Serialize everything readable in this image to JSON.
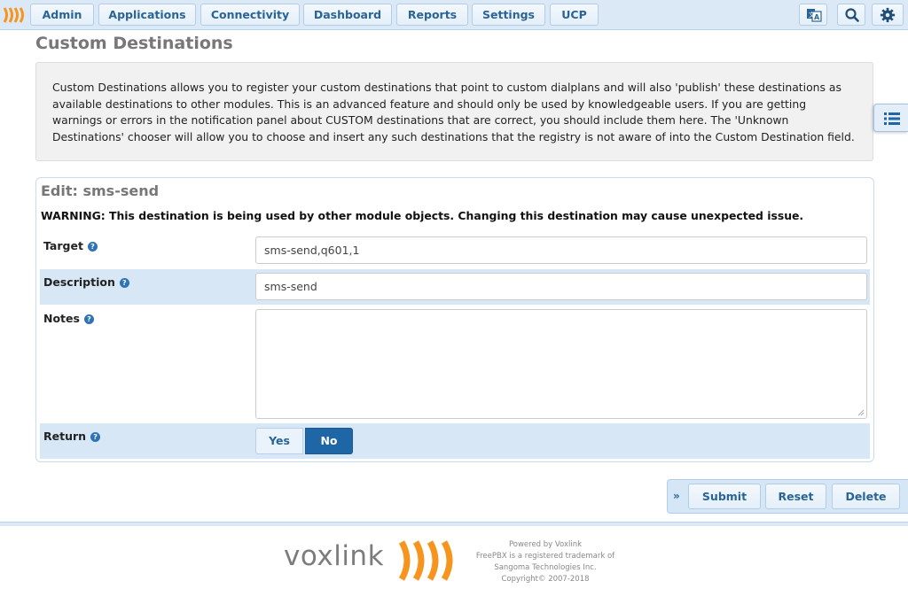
{
  "nav": {
    "items": [
      "Admin",
      "Applications",
      "Connectivity",
      "Dashboard",
      "Reports",
      "Settings",
      "UCP"
    ]
  },
  "page": {
    "title": "Custom Destinations",
    "description": "Custom Destinations allows you to register your custom destinations that point to custom dialplans and will also 'publish' these destinations as available destinations to other modules. This is an advanced feature and should only be used by knowledgeable users. If you are getting warnings or errors in the notification panel about CUSTOM destinations that are correct, you should include them here. The 'Unknown Destinations' chooser will allow you to choose and insert any such destinations that the registry is not aware of into the Custom Destination field."
  },
  "edit": {
    "title": "Edit: sms-send",
    "warning": "WARNING: This destination is being used by other module objects. Changing this destination may cause unexpected issue.",
    "target_label": "Target",
    "target_value": "sms-send,q601,1",
    "description_label": "Description",
    "description_value": "sms-send",
    "notes_label": "Notes",
    "notes_value": "",
    "return_label": "Return",
    "return_yes": "Yes",
    "return_no": "No"
  },
  "actions": {
    "submit": "Submit",
    "reset": "Reset",
    "delete": "Delete"
  },
  "footer": {
    "logo": "voxlink",
    "lines": [
      "Powered by Voxlink",
      "FreePBX is a registered trademark of",
      "Sangoma Technologies Inc.",
      "Copyright© 2007-2018"
    ]
  },
  "colors": {
    "accent": "#2a6496",
    "active_toggle": "#1f66a6",
    "nav_bg": "#dbe9f7",
    "brand_orange": "#f7941d"
  },
  "icons": [
    "brand-logo-icon",
    "language-icon",
    "search-icon",
    "gear-icon",
    "list-icon",
    "help-icon",
    "chevron-right-icon"
  ]
}
